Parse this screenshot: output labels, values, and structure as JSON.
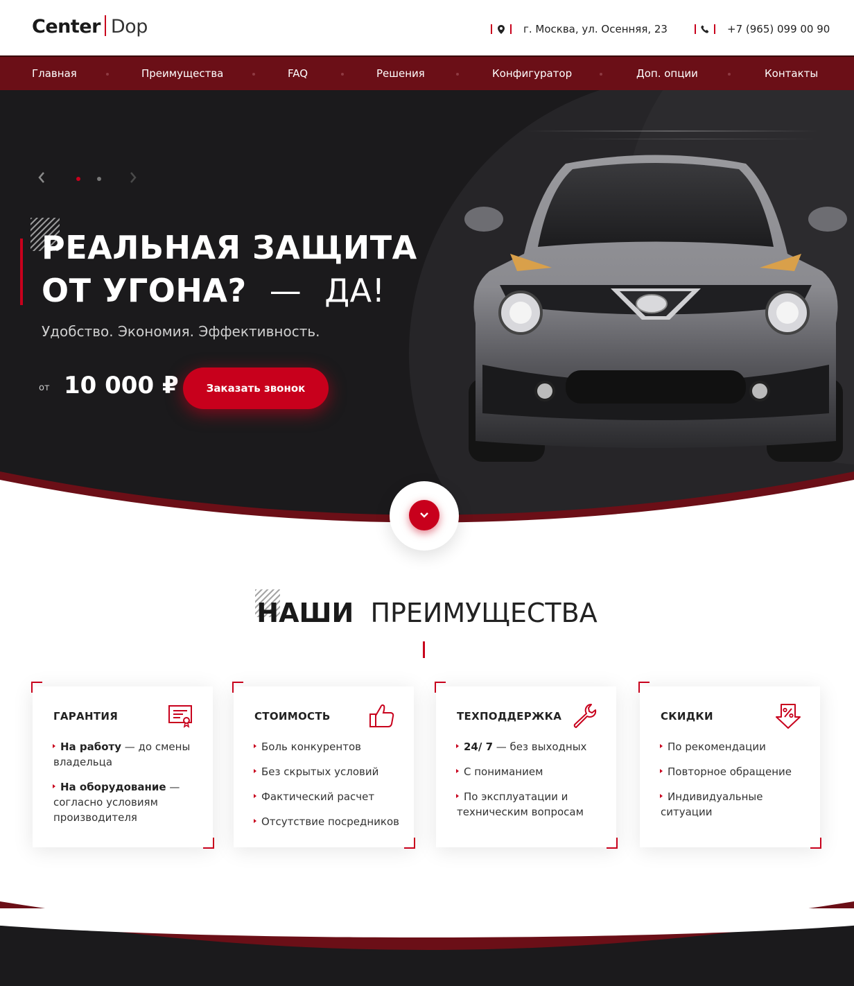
{
  "header": {
    "logo_left": "Center",
    "logo_right": "Dop",
    "address": "г. Москва, ул. Осенняя, 23",
    "phone": "+7 (965) 099 00 90"
  },
  "nav": [
    "Главная",
    "Преимущества",
    "FAQ",
    "Решения",
    "Конфигуратор",
    "Доп. опции",
    "Контакты"
  ],
  "hero": {
    "title_line1": "РЕАЛЬНАЯ ЗАЩИТА",
    "title_line2_bold": "ОТ УГОНА?",
    "title_line2_dash": "—",
    "title_line2_light": "ДА!",
    "subtitle": "Удобство. Экономия. Эффективность.",
    "price_prefix": "от",
    "price": "10 000 ₽",
    "cta_label": "Заказать звонок",
    "slide_count": 2,
    "active_slide": 1
  },
  "advantages": {
    "title_bold": "НАШИ",
    "title_light": "ПРЕИМУЩЕСТВА",
    "cards": [
      {
        "title": "ГАРАНТИЯ",
        "icon": "certificate-icon",
        "items": [
          {
            "bold": "На работу",
            "text": " — до смены владельца"
          },
          {
            "bold": "На оборудование",
            "text": " — согласно условиям производителя"
          }
        ]
      },
      {
        "title": "СТОИМОСТЬ",
        "icon": "thumbs-up-icon",
        "items": [
          {
            "bold": "",
            "text": "Боль конкурентов"
          },
          {
            "bold": "",
            "text": "Без скрытых условий"
          },
          {
            "bold": "",
            "text": "Фактический расчет"
          },
          {
            "bold": "",
            "text": "Отсутствие посредников"
          }
        ]
      },
      {
        "title": "ТЕХПОДДЕРЖКА",
        "icon": "wrench-icon",
        "items": [
          {
            "bold": "24/ 7",
            "text": " — без выходных"
          },
          {
            "bold": "",
            "text": "С пониманием"
          },
          {
            "bold": "",
            "text": "По эксплуатации и техническим вопросам"
          }
        ]
      },
      {
        "title": "СКИДКИ",
        "icon": "discount-icon",
        "items": [
          {
            "bold": "",
            "text": "По рекомендации"
          },
          {
            "bold": "",
            "text": "Повторное обращение"
          },
          {
            "bold": "",
            "text": "Индивидуальные ситуации"
          }
        ]
      }
    ]
  },
  "colors": {
    "accent": "#c8001c",
    "nav_bg": "#6b0f17",
    "hero_bg": "#1b1a1c"
  }
}
